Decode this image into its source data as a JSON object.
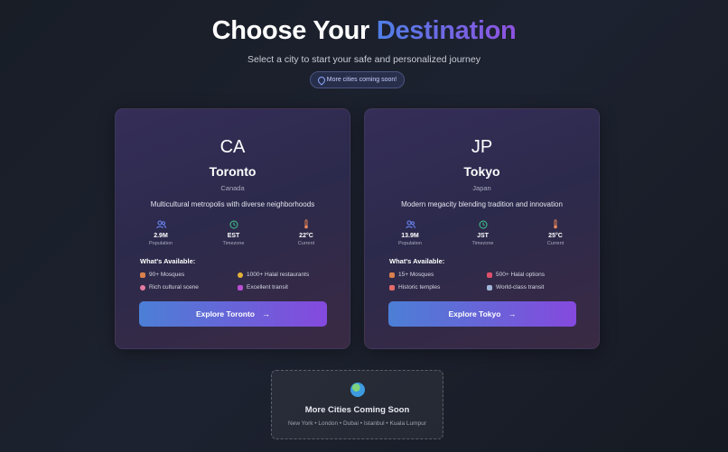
{
  "header": {
    "title_prefix": "Choose Your ",
    "title_accent": "Destination",
    "subtitle": "Select a city to start your safe and personalized journey",
    "badge": "More cities coming soon!"
  },
  "cities": [
    {
      "code": "CA",
      "name": "Toronto",
      "country": "Canada",
      "description": "Multicultural metropolis with diverse neighborhoods",
      "stats": [
        {
          "icon": "users-icon",
          "value": "2.9M",
          "label": "Population"
        },
        {
          "icon": "clock-icon",
          "value": "EST",
          "label": "Timezone"
        },
        {
          "icon": "thermometer-icon",
          "value": "22°C",
          "label": "Current"
        }
      ],
      "available_title": "What's Available:",
      "features": [
        "90+ Mosques",
        "1000+ Halal restaurants",
        "Rich cultural scene",
        "Excellent transit"
      ],
      "button": "Explore Toronto"
    },
    {
      "code": "JP",
      "name": "Tokyo",
      "country": "Japan",
      "description": "Modern megacity blending tradition and innovation",
      "stats": [
        {
          "icon": "users-icon",
          "value": "13.9M",
          "label": "Population"
        },
        {
          "icon": "clock-icon",
          "value": "JST",
          "label": "Timezone"
        },
        {
          "icon": "thermometer-icon",
          "value": "25°C",
          "label": "Current"
        }
      ],
      "available_title": "What's Available:",
      "features": [
        "15+ Mosques",
        "500+ Halal options",
        "Historic temples",
        "World-class transit"
      ],
      "button": "Explore Tokyo"
    }
  ],
  "more": {
    "icon": "globe-icon",
    "title": "More Cities Coming Soon",
    "list": "New York • London • Dubai • Istanbul • Kuala Lumpur"
  },
  "colors": {
    "accent_start": "#4f7fe6",
    "accent_end": "#8f52e0",
    "background": "#1d2230"
  }
}
